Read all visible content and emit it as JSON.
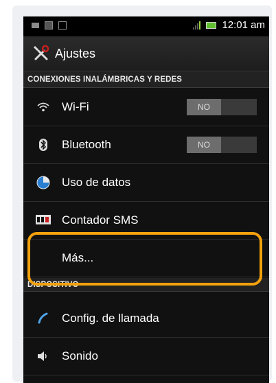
{
  "status_bar": {
    "time": "12:01 am"
  },
  "app_title": "Ajustes",
  "sections": [
    {
      "header": "CONEXIONES INALÁMBRICAS Y REDES"
    },
    {
      "header": "DISPOSITIVO"
    }
  ],
  "items": [
    {
      "label": "Wi-Fi",
      "icon": "wifi-icon",
      "toggle": "NO"
    },
    {
      "label": "Bluetooth",
      "icon": "bluetooth-icon",
      "toggle": "NO"
    },
    {
      "label": "Uso de datos",
      "icon": "data-usage-icon"
    },
    {
      "label": "Contador SMS",
      "icon": "sms-counter-icon"
    },
    {
      "label": "Más..."
    },
    {
      "label": "Config. de llamada",
      "icon": "phone-icon"
    },
    {
      "label": "Sonido",
      "icon": "speaker-icon"
    }
  ],
  "colors": {
    "highlight": "#f2a20c",
    "screen_bg": "#111111"
  }
}
